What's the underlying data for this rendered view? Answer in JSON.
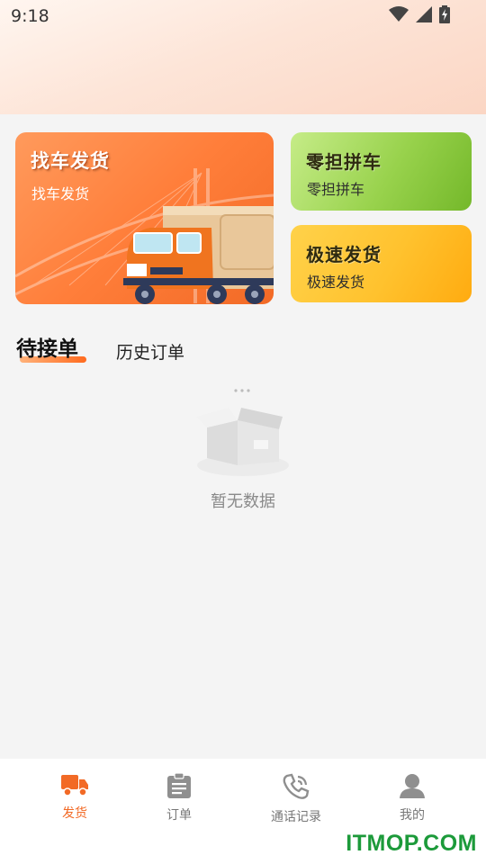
{
  "status_bar": {
    "time": "9:18"
  },
  "cards": {
    "main": {
      "title": "找车发货",
      "subtitle": "找车发货"
    },
    "carpool": {
      "title": "零担拼车",
      "subtitle": "零担拼车"
    },
    "express": {
      "title": "极速发货",
      "subtitle": "极速发货"
    }
  },
  "tabs": [
    {
      "label": "待接单",
      "active": true
    },
    {
      "label": "历史订单",
      "active": false
    }
  ],
  "empty_state": {
    "text": "暂无数据"
  },
  "bottom_nav": [
    {
      "label": "发货",
      "icon": "truck-icon",
      "active": true
    },
    {
      "label": "订单",
      "icon": "clipboard-icon",
      "active": false
    },
    {
      "label": "通话记录",
      "icon": "phone-icon",
      "active": false
    },
    {
      "label": "我的",
      "icon": "user-icon",
      "active": false
    }
  ],
  "watermark": "ITMOP.COM",
  "colors": {
    "accent": "#f26a26",
    "green": "#98d24c",
    "yellow": "#ffc22e",
    "watermark": "#1c9a3a"
  }
}
